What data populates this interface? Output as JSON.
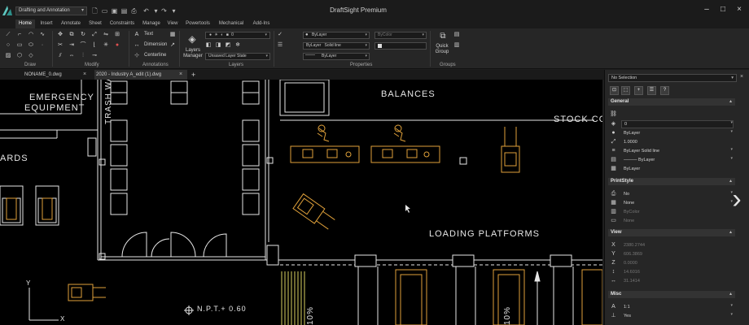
{
  "app": {
    "title": "DraftSight Premium",
    "workspace": "Drafting and Annotation",
    "colors": {
      "accent": "#5ec7c0",
      "cad_orange": "#e0a13a",
      "cad_white": "#e6e6e6",
      "cad_yellow": "#d8d060"
    }
  },
  "menu": {
    "tabs": [
      "Home",
      "Insert",
      "Annotate",
      "Sheet",
      "Constraints",
      "Manage",
      "View",
      "Powertools",
      "Mechanical",
      "Add-Ins"
    ],
    "active": "Home"
  },
  "ribbon": {
    "groups": [
      "Draw",
      "Modify",
      "Annotations",
      "Layers",
      "Properties",
      "Groups"
    ],
    "annotations": {
      "text": "Text",
      "dimension": "Dimension",
      "centerline": "Centerline"
    },
    "layers": {
      "manager_line1": "Layers",
      "manager_line2": "Manager",
      "state": "Unsaved Layer State"
    },
    "properties": {
      "color": "ByLayer",
      "linetype_row": [
        "ByLayer",
        "Solid line"
      ],
      "lineweight": "ByLayer",
      "plotstyle": "ByColor"
    },
    "quick_group": [
      "Quick",
      "Group"
    ]
  },
  "doc_tabs": [
    {
      "label": "NONAME_0.dwg",
      "active": false
    },
    {
      "label": "2020 - Industry A_edit (1).dwg",
      "active": true
    }
  ],
  "drawing": {
    "labels": {
      "emergency1": "EMERGENCY",
      "emergency2": "EQUIPMENT",
      "balances": "BALANCES",
      "stock": "STOCK CO",
      "ards": "ARDS",
      "trash": "TRASH WAREHO",
      "loading": "LOADING PLATFORMS",
      "npt": "N.P.T.+ 0.60",
      "pct_left": "10%",
      "pct_right": "10%"
    },
    "axis": {
      "x": "X",
      "y": "Y"
    }
  },
  "properties_panel": {
    "selection": "No Selection",
    "sections": {
      "general": "General",
      "printstyle": "PrintStyle",
      "view": "View",
      "misc": "Misc"
    },
    "general": [
      "0",
      "ByLayer",
      "1.0000",
      "ByLayer     Solid line",
      "——— ByLayer",
      "ByLayer"
    ],
    "printstyle": [
      "No",
      "None",
      "ByColor",
      "None"
    ],
    "view": [
      "2380.2744",
      "606.3869",
      "0.0000",
      "14.6016",
      "31.1414"
    ],
    "misc": [
      "1:1",
      "Yes"
    ]
  }
}
